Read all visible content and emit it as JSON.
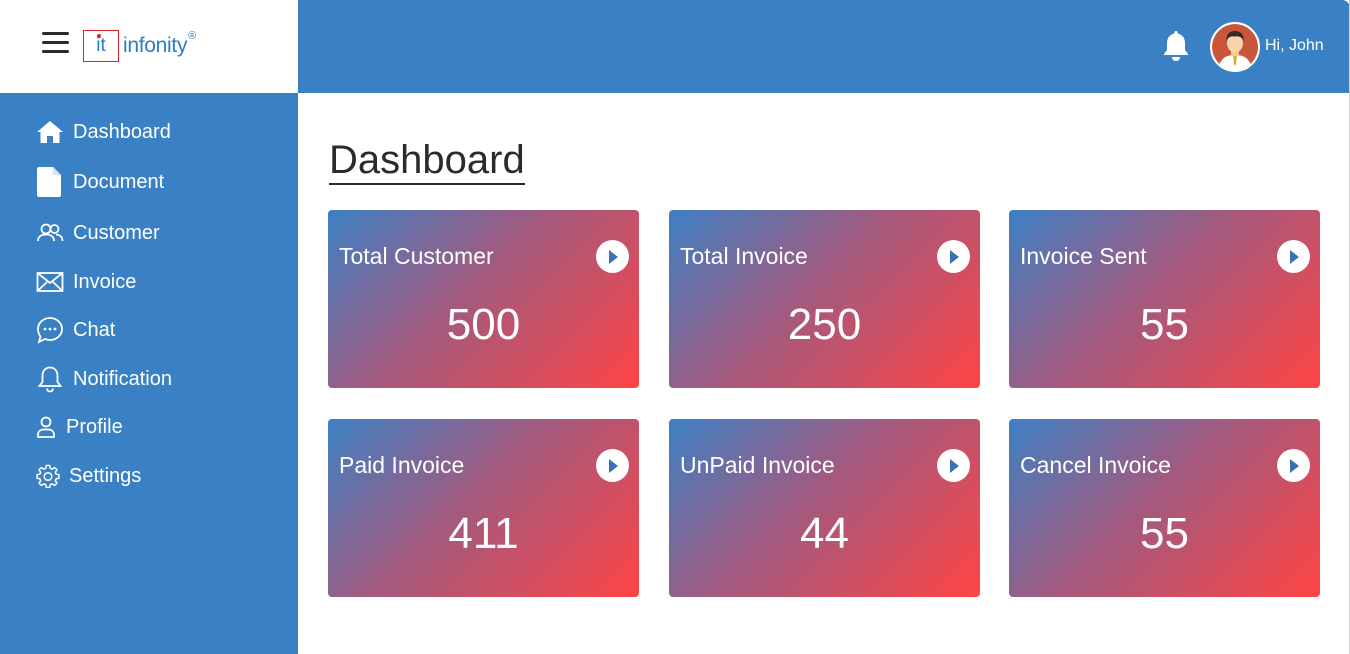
{
  "header": {
    "logo_it": "it",
    "logo_word": "infonity",
    "logo_reg": "®",
    "greeting": "Hi, John"
  },
  "sidebar": {
    "items": [
      {
        "label": "Dashboard",
        "icon": "home-icon"
      },
      {
        "label": "Document",
        "icon": "document-icon"
      },
      {
        "label": "Customer",
        "icon": "users-icon"
      },
      {
        "label": "Invoice",
        "icon": "envelope-icon"
      },
      {
        "label": "Chat",
        "icon": "chat-icon"
      },
      {
        "label": "Notification",
        "icon": "bell-icon"
      },
      {
        "label": "Profile",
        "icon": "user-icon"
      },
      {
        "label": "Settings",
        "icon": "gear-icon"
      }
    ]
  },
  "main": {
    "title": "Dashboard",
    "cards": [
      {
        "title": "Total Customer",
        "value": "500"
      },
      {
        "title": "Total Invoice",
        "value": "250"
      },
      {
        "title": "Invoice Sent",
        "value": "55"
      },
      {
        "title": "Paid Invoice",
        "value": "411"
      },
      {
        "title": "UnPaid Invoice",
        "value": "44"
      },
      {
        "title": "Cancel Invoice",
        "value": "55"
      }
    ]
  },
  "colors": {
    "primary": "#3981c4",
    "gradient_start": "#3d80c4",
    "gradient_end": "#ff4444",
    "logo_red": "#d9232e"
  }
}
